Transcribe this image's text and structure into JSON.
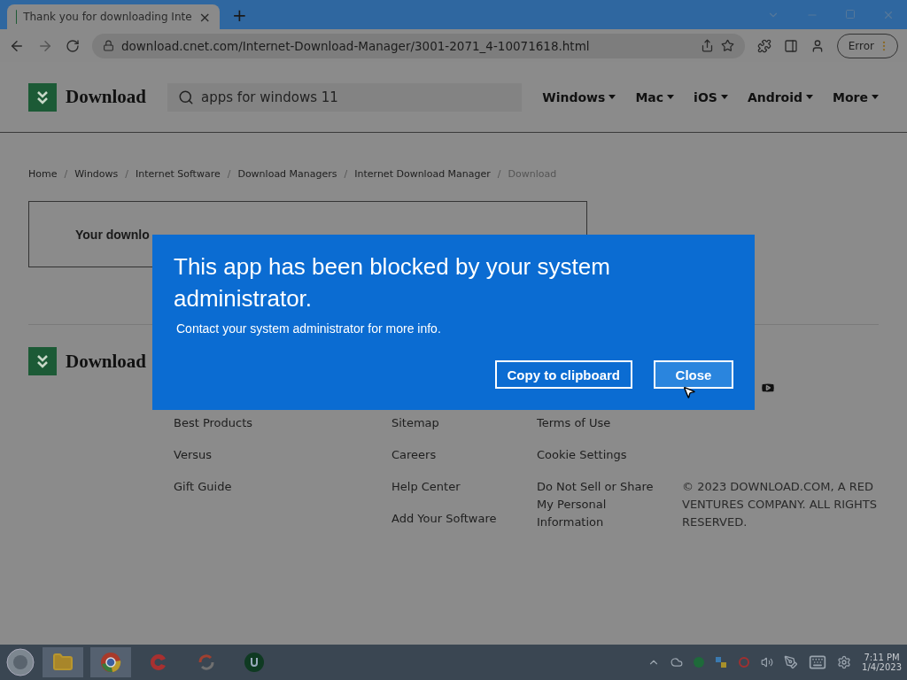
{
  "browser": {
    "tab": {
      "title": "Thank you for downloading Inte",
      "close": "×"
    },
    "new_tab": "+",
    "url": "download.cnet.com/Internet-Download-Manager/3001-2071_4-10071618.html",
    "profile_button": "Error"
  },
  "site": {
    "logo": "Download",
    "search": {
      "value": "apps for windows 11"
    },
    "nav": [
      "Windows",
      "Mac",
      "iOS",
      "Android",
      "More"
    ]
  },
  "breadcrumb_separator": "/",
  "breadcrumbs": [
    {
      "label": "Home",
      "current": false
    },
    {
      "label": "Windows",
      "current": false
    },
    {
      "label": "Internet Software",
      "current": false
    },
    {
      "label": "Download Managers",
      "current": false
    },
    {
      "label": "Internet Download Manager",
      "current": false
    },
    {
      "label": "Download",
      "current": true
    }
  ],
  "notice": "Your downlo",
  "footer": {
    "logo": "Download",
    "columns": [
      [
        "Best Products",
        "Versus",
        "Gift Guide"
      ],
      [
        "Sitemap",
        "Careers",
        "Help Center",
        "Add Your Software"
      ],
      [
        "Terms of Use",
        "Cookie Settings",
        "Do Not Sell or Share My Personal Information"
      ]
    ],
    "copyright": "© 2023 DOWNLOAD.COM, A RED VENTURES COMPANY. ALL RIGHTS RESERVED."
  },
  "dialog": {
    "title": "This app has been blocked by your system administrator.",
    "message": "Contact your system administrator for more info.",
    "buttons": [
      {
        "label": "Copy to clipboard",
        "hovered": false
      },
      {
        "label": "Close",
        "hovered": true
      }
    ]
  },
  "taskbar": {
    "time": "7:11 PM",
    "date": "1/4/2023"
  }
}
